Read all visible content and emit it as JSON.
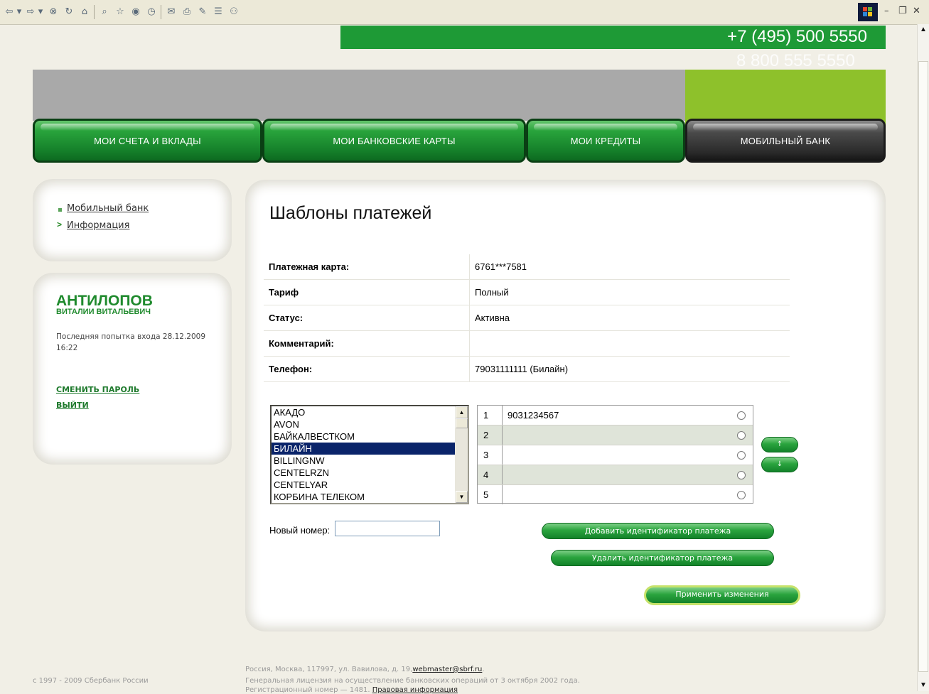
{
  "header": {
    "phone_main": "+7 (495) 500 5550",
    "phone_free": "8 800 555 5550"
  },
  "nav": [
    {
      "label": "МОИ СЧЕТА И ВКЛАДЫ"
    },
    {
      "label": "МОИ БАНКОВСКИЕ КАРТЫ"
    },
    {
      "label": "МОИ КРЕДИТЫ"
    },
    {
      "label": "МОБИЛЬНЫЙ БАНК"
    }
  ],
  "sidebar": {
    "menu": [
      {
        "label": "Мобильный банк"
      },
      {
        "label": "Информация"
      }
    ],
    "user": {
      "surname": "АНТИЛОПОВ",
      "given": "ВИТАЛИИ ВИТАЛЬЕВИЧ",
      "last_login": "Последняя попытка входа 28.12.2009 16:22"
    },
    "change_password": "СМЕНИТЬ ПАРОЛЬ",
    "logout": "ВЫЙТИ"
  },
  "main": {
    "title": "Шаблоны платежей",
    "info": [
      {
        "label": "Платежная карта:",
        "value": "6761***7581"
      },
      {
        "label": "Тариф",
        "value": "Полный"
      },
      {
        "label": "Статус:",
        "value": "Активна"
      },
      {
        "label": "Комментарий:",
        "value": ""
      },
      {
        "label": "Телефон:",
        "value": "79031111111 (Билайн)"
      }
    ],
    "operators": [
      "АКАДО",
      "AVON",
      "БАЙКАЛВЕСТКОМ",
      "БИЛАЙН",
      "BILLINGNW",
      "CENTELRZN",
      "CENTELYAR",
      "КОРБИНА ТЕЛЕКОМ"
    ],
    "selected_operator": "БИЛАЙН",
    "numbers": [
      {
        "idx": "1",
        "value": "9031234567"
      },
      {
        "idx": "2",
        "value": ""
      },
      {
        "idx": "3",
        "value": ""
      },
      {
        "idx": "4",
        "value": ""
      },
      {
        "idx": "5",
        "value": ""
      }
    ],
    "move_up": "↑",
    "move_down": "↓",
    "new_number_label": "Новый номер:",
    "new_number_value": "",
    "add_button": "Добавить идентификатор платежа",
    "remove_button": "Удалить идентификатор платежа",
    "apply_button": "Применить изменения"
  },
  "footer": {
    "copyright": "с 1997 - 2009 Сбербанк России",
    "address": "Россия, Москва, 117997, ул. Вавилова, д. 19,",
    "email": "webmaster@sbrf.ru",
    "email_suffix": ".",
    "license": "Генеральная лицензия на осуществление банковских операций от 3 октября 2002 года.",
    "regnum": "Регистрационный номер — 1481.",
    "legal_link": "Правовая информация"
  },
  "colors": {
    "brand_green": "#1e9a36",
    "lime": "#8ec12b",
    "selection": "#0a246a"
  }
}
